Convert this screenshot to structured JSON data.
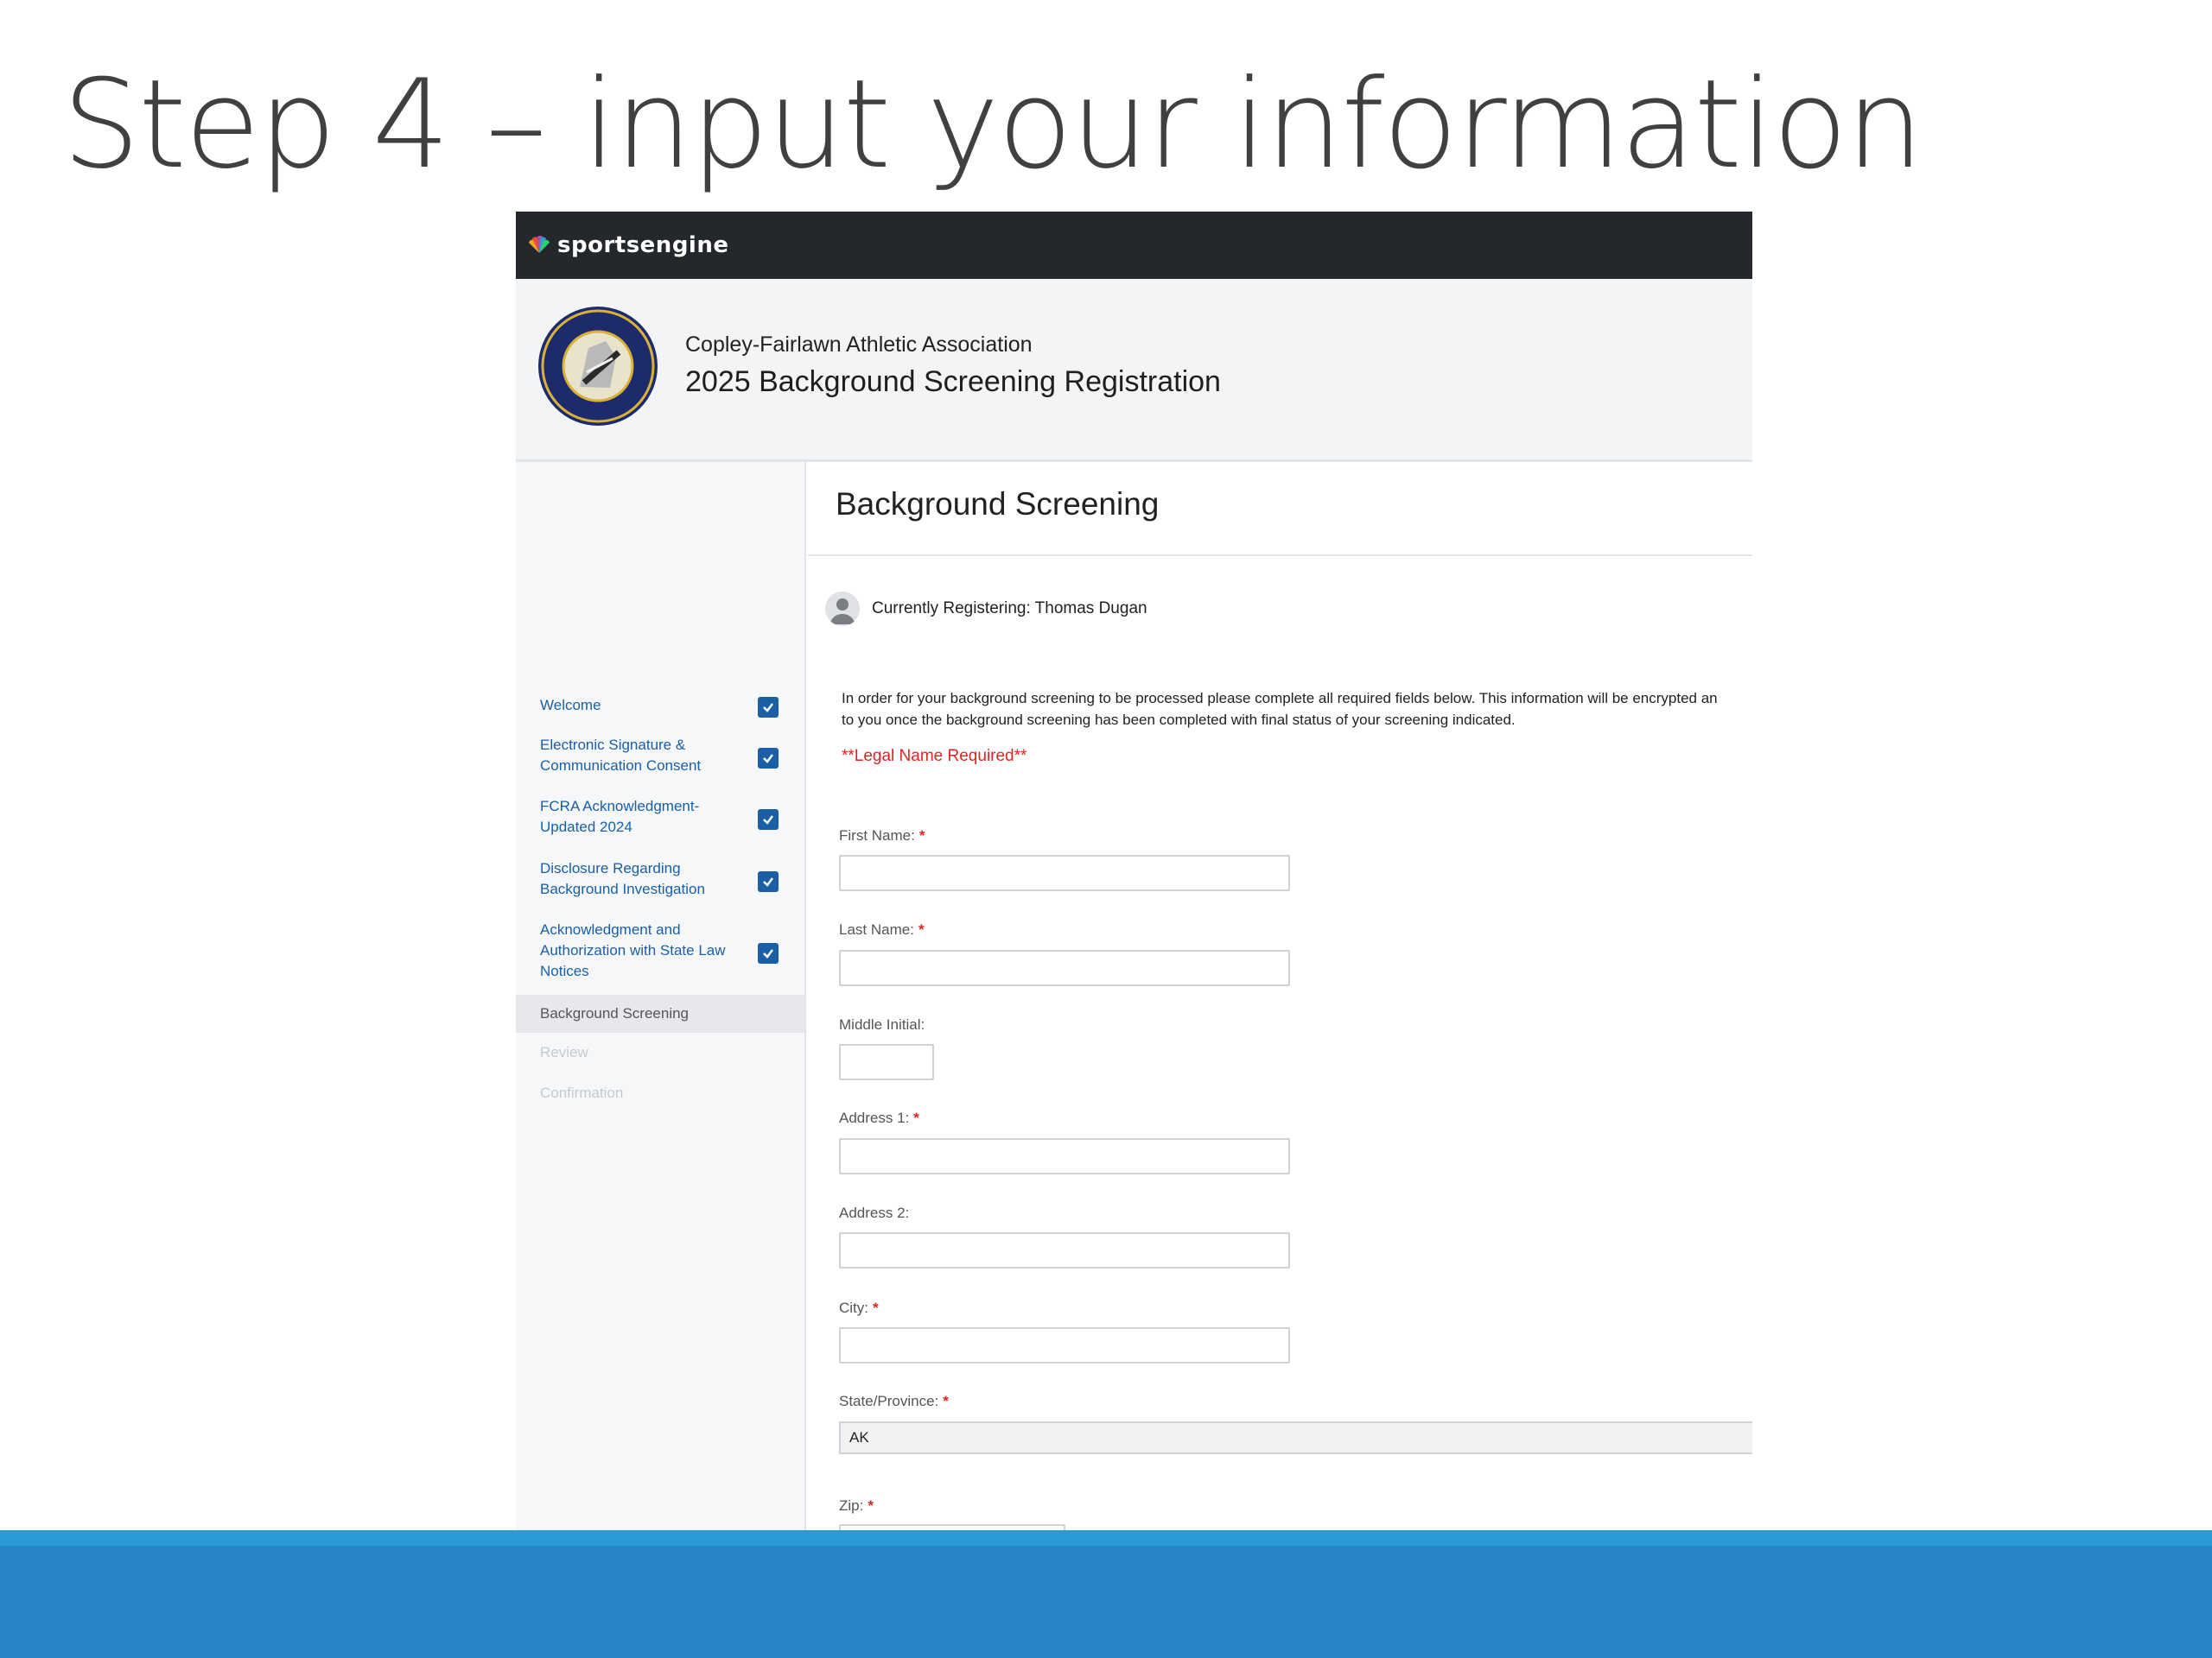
{
  "slide": {
    "title": "Step 4 – input your information"
  },
  "app": {
    "brand": "sportsengine",
    "org_name": "Copley-Fairlawn Athletic Association",
    "registration_title": "2025 Background Screening Registration"
  },
  "sidebar": {
    "items": [
      {
        "label": "Welcome",
        "checked": true
      },
      {
        "label": "Electronic Signature & Communication Consent",
        "checked": true
      },
      {
        "label": "FCRA Acknowledgment- Updated 2024",
        "checked": true
      },
      {
        "label": "Disclosure Regarding Background Investigation",
        "checked": true
      },
      {
        "label": "Acknowledgment and Authorization with State Law Notices",
        "checked": true
      },
      {
        "label": "Background Screening",
        "state": "current"
      },
      {
        "label": "Review",
        "state": "disabled"
      },
      {
        "label": "Confirmation",
        "state": "disabled"
      }
    ]
  },
  "main": {
    "title": "Background Screening",
    "registering": "Currently Registering: Thomas Dugan",
    "intro_line1": "In order for your background screening to be processed please complete all required fields below. This information will be encrypted an",
    "intro_line2": "to you once the background screening has been completed with final status of your screening indicated.",
    "legal_notice": "**Legal Name Required**",
    "required_marker": "*",
    "fields": {
      "first_name": {
        "label": "First Name:",
        "value": ""
      },
      "last_name": {
        "label": "Last Name:",
        "value": ""
      },
      "middle_initial": {
        "label": "Middle Initial:",
        "value": ""
      },
      "address1": {
        "label": "Address 1:",
        "value": ""
      },
      "address2": {
        "label": "Address 2:",
        "value": ""
      },
      "city": {
        "label": "City:",
        "value": ""
      },
      "state": {
        "label": "State/Province:",
        "value": "AK"
      },
      "zip": {
        "label": "Zip:",
        "value": ""
      }
    }
  },
  "colors": {
    "topbar": "#24272b",
    "link": "#1a5fa6",
    "required": "#e02424",
    "footer_band": "#2884c6",
    "footer_line": "#2b9bd6"
  }
}
